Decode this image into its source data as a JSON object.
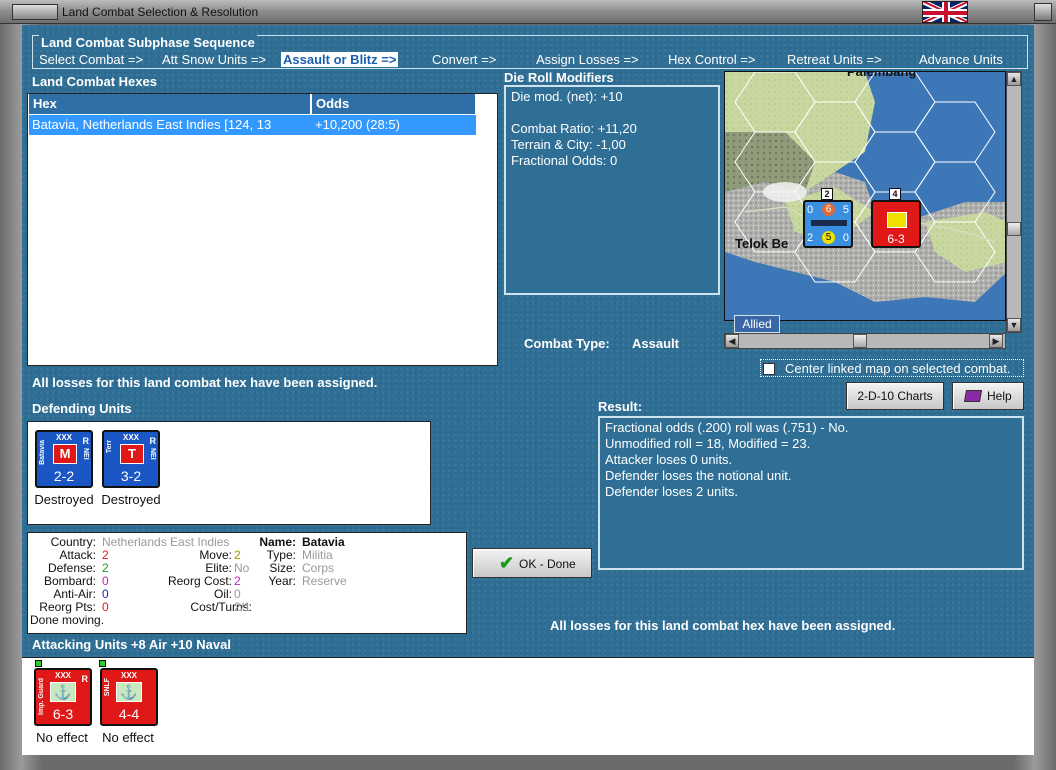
{
  "window": {
    "title": "Land Combat Selection & Resolution"
  },
  "sequence": {
    "title": "Land Combat Subphase Sequence",
    "steps": [
      "Select Combat =>",
      "Att Snow Units =>",
      "Assault or Blitz =>",
      "Convert =>",
      "Assign Losses =>",
      "Hex Control =>",
      "Retreat Units =>",
      "Advance Units"
    ],
    "active_index": 2
  },
  "hexes": {
    "title": "Land Combat Hexes",
    "columns": [
      "Hex",
      "Odds"
    ],
    "rows": [
      {
        "hex": "Batavia, Netherlands East Indies [124, 13",
        "odds": "+10,200 (28:5)"
      }
    ]
  },
  "die_roll": {
    "title": "Die Roll Modifiers",
    "net": "Die mod. (net): +10",
    "lines": [
      "Combat Ratio: +11,20",
      "Terrain & City: -1,00",
      "Fractional Odds: 0"
    ]
  },
  "map": {
    "labels": [
      "Palembang",
      "Telok Be"
    ],
    "tab": "Allied",
    "stack_top": "2",
    "stack_right": "4",
    "naval_counter": {
      "top_left": "0",
      "top_mid": "6",
      "top_right": "5",
      "bottom_left": "2",
      "bottom_mid": "5",
      "bottom_right": "0"
    },
    "land_counter": {
      "strength": "6-3"
    }
  },
  "combat_type": {
    "label": "Combat Type:",
    "value": "Assault"
  },
  "center_map": {
    "label": "Center linked map on selected combat."
  },
  "losses_msg_1": "All losses for this land combat hex have been assigned.",
  "losses_msg_2": "All losses for this land combat hex have been assigned.",
  "buttons": {
    "charts": "2-D-10 Charts",
    "help": "Help",
    "ok": "OK - Done"
  },
  "result": {
    "title": "Result:",
    "lines": [
      "Fractional odds (.200) roll was (.751)  - No.",
      "Unmodified roll = 18, Modified = 23.",
      "Attacker loses 0 units.",
      "Defender loses the notional unit.",
      "Defender loses 2 units."
    ]
  },
  "defending": {
    "title": "Defending Units",
    "units": [
      {
        "name": "Batavia",
        "sym": "M",
        "strength": "2-2",
        "size": "XXX",
        "r": "R",
        "nat": "NEI",
        "status": "Destroyed"
      },
      {
        "name": "Terr",
        "sym": "T",
        "strength": "3-2",
        "size": "XXX",
        "r": "R",
        "nat": "NEI",
        "status": "Destroyed"
      }
    ]
  },
  "stats": {
    "country_label": "Country:",
    "country": "Netherlands East Indies",
    "attack_label": "Attack:",
    "attack": "2",
    "defense_label": "Defense:",
    "defense": "2",
    "bombard_label": "Bombard:",
    "bombard": "0",
    "antiair_label": "Anti-Air:",
    "antiair": "0",
    "reorg_pts_label": "Reorg Pts:",
    "reorg_pts": "0",
    "done": "Done moving.",
    "move_label": "Move:",
    "move": "2",
    "elite_label": "Elite:",
    "elite": "No",
    "reorg_cost_label": "Reorg Cost:",
    "reorg_cost": "2",
    "oil_label": "Oil:",
    "oil": "0",
    "cost_turns_label": "Cost/Turns:",
    "cost_turns": "2/1",
    "name_label": "Name:",
    "name": "Batavia",
    "type_label": "Type:",
    "type": "Militia",
    "size_label": "Size:",
    "size": "Corps",
    "year_label": "Year:",
    "year": "Reserve"
  },
  "attacking": {
    "title": "Attacking Units +8 Air +10 Naval",
    "units": [
      {
        "name": "Imp. Guard",
        "strength": "6-3",
        "size": "XXX",
        "r": "R",
        "status": "No effect"
      },
      {
        "name": "SNLF",
        "strength": "4-4",
        "size": "XXX",
        "r": "",
        "status": "No effect"
      }
    ]
  },
  "colors": {
    "panel_blue": "#2f6f96",
    "axis_red": "#e01818",
    "allied_blue": "#1a56c4",
    "highlight": "#3399ff"
  }
}
